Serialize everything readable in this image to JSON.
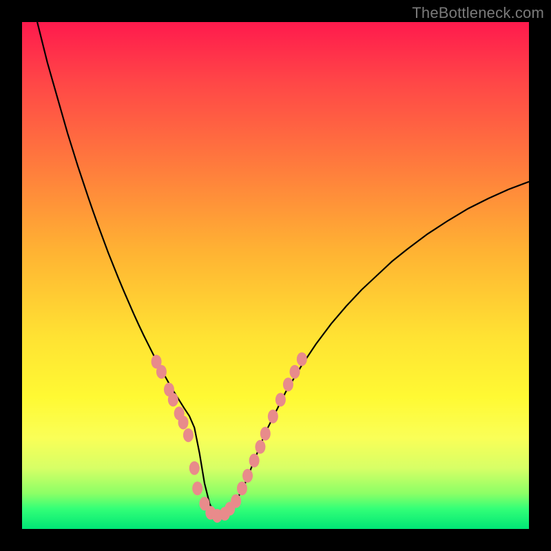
{
  "watermark": "TheBottleneck.com",
  "colors": {
    "background": "#000000",
    "gradient_top": "#ff1a4d",
    "gradient_mid": "#ffe233",
    "gradient_bottom": "#00e676",
    "curve": "#000000",
    "markers": "#e88b8b"
  },
  "chart_data": {
    "type": "line",
    "title": "",
    "xlabel": "",
    "ylabel": "",
    "xlim": [
      0,
      100
    ],
    "ylim": [
      0,
      100
    ],
    "series": [
      {
        "name": "bottleneck-curve",
        "x": [
          3,
          4,
          5,
          6,
          7,
          8,
          9,
          10,
          11,
          12,
          13,
          14,
          15,
          16,
          17,
          18,
          19,
          20,
          21,
          22,
          23,
          24,
          25,
          26,
          27,
          28,
          29,
          30,
          31,
          32,
          33,
          34,
          35,
          36,
          37,
          38,
          39,
          40,
          42,
          44,
          46,
          48,
          50,
          52,
          55,
          58,
          61,
          64,
          67,
          70,
          73,
          76,
          80,
          84,
          88,
          92,
          96,
          100
        ],
        "y": [
          100,
          96,
          92,
          88.5,
          85,
          81.5,
          78,
          74.8,
          71.6,
          68.6,
          65.6,
          62.7,
          59.9,
          57.2,
          54.5,
          52,
          49.5,
          47.1,
          44.8,
          42.5,
          40.3,
          38.2,
          36.2,
          34.2,
          32.3,
          30.5,
          28.7,
          27,
          25.4,
          23.8,
          22.3,
          20,
          15,
          9,
          5,
          3,
          2.5,
          3,
          5,
          9,
          14,
          19,
          23,
          27,
          32,
          36.5,
          40.5,
          44,
          47.2,
          50,
          52.8,
          55.2,
          58.2,
          60.8,
          63.2,
          65.2,
          67,
          68.5
        ]
      }
    ],
    "markers": {
      "name": "highlighted-points",
      "points": [
        {
          "x": 26.5,
          "y": 33
        },
        {
          "x": 27.5,
          "y": 31
        },
        {
          "x": 29,
          "y": 27.5
        },
        {
          "x": 29.8,
          "y": 25.5
        },
        {
          "x": 31,
          "y": 22.8
        },
        {
          "x": 31.8,
          "y": 21
        },
        {
          "x": 32.8,
          "y": 18.5
        },
        {
          "x": 34,
          "y": 12
        },
        {
          "x": 34.6,
          "y": 8
        },
        {
          "x": 36,
          "y": 5
        },
        {
          "x": 37.2,
          "y": 3.2
        },
        {
          "x": 38.5,
          "y": 2.6
        },
        {
          "x": 40,
          "y": 3
        },
        {
          "x": 41,
          "y": 4
        },
        {
          "x": 42.2,
          "y": 5.5
        },
        {
          "x": 43.4,
          "y": 8
        },
        {
          "x": 44.5,
          "y": 10.5
        },
        {
          "x": 45.8,
          "y": 13.5
        },
        {
          "x": 47,
          "y": 16.2
        },
        {
          "x": 48,
          "y": 18.8
        },
        {
          "x": 49.5,
          "y": 22.2
        },
        {
          "x": 51,
          "y": 25.5
        },
        {
          "x": 52.5,
          "y": 28.5
        },
        {
          "x": 53.8,
          "y": 31
        },
        {
          "x": 55.2,
          "y": 33.5
        }
      ]
    }
  }
}
